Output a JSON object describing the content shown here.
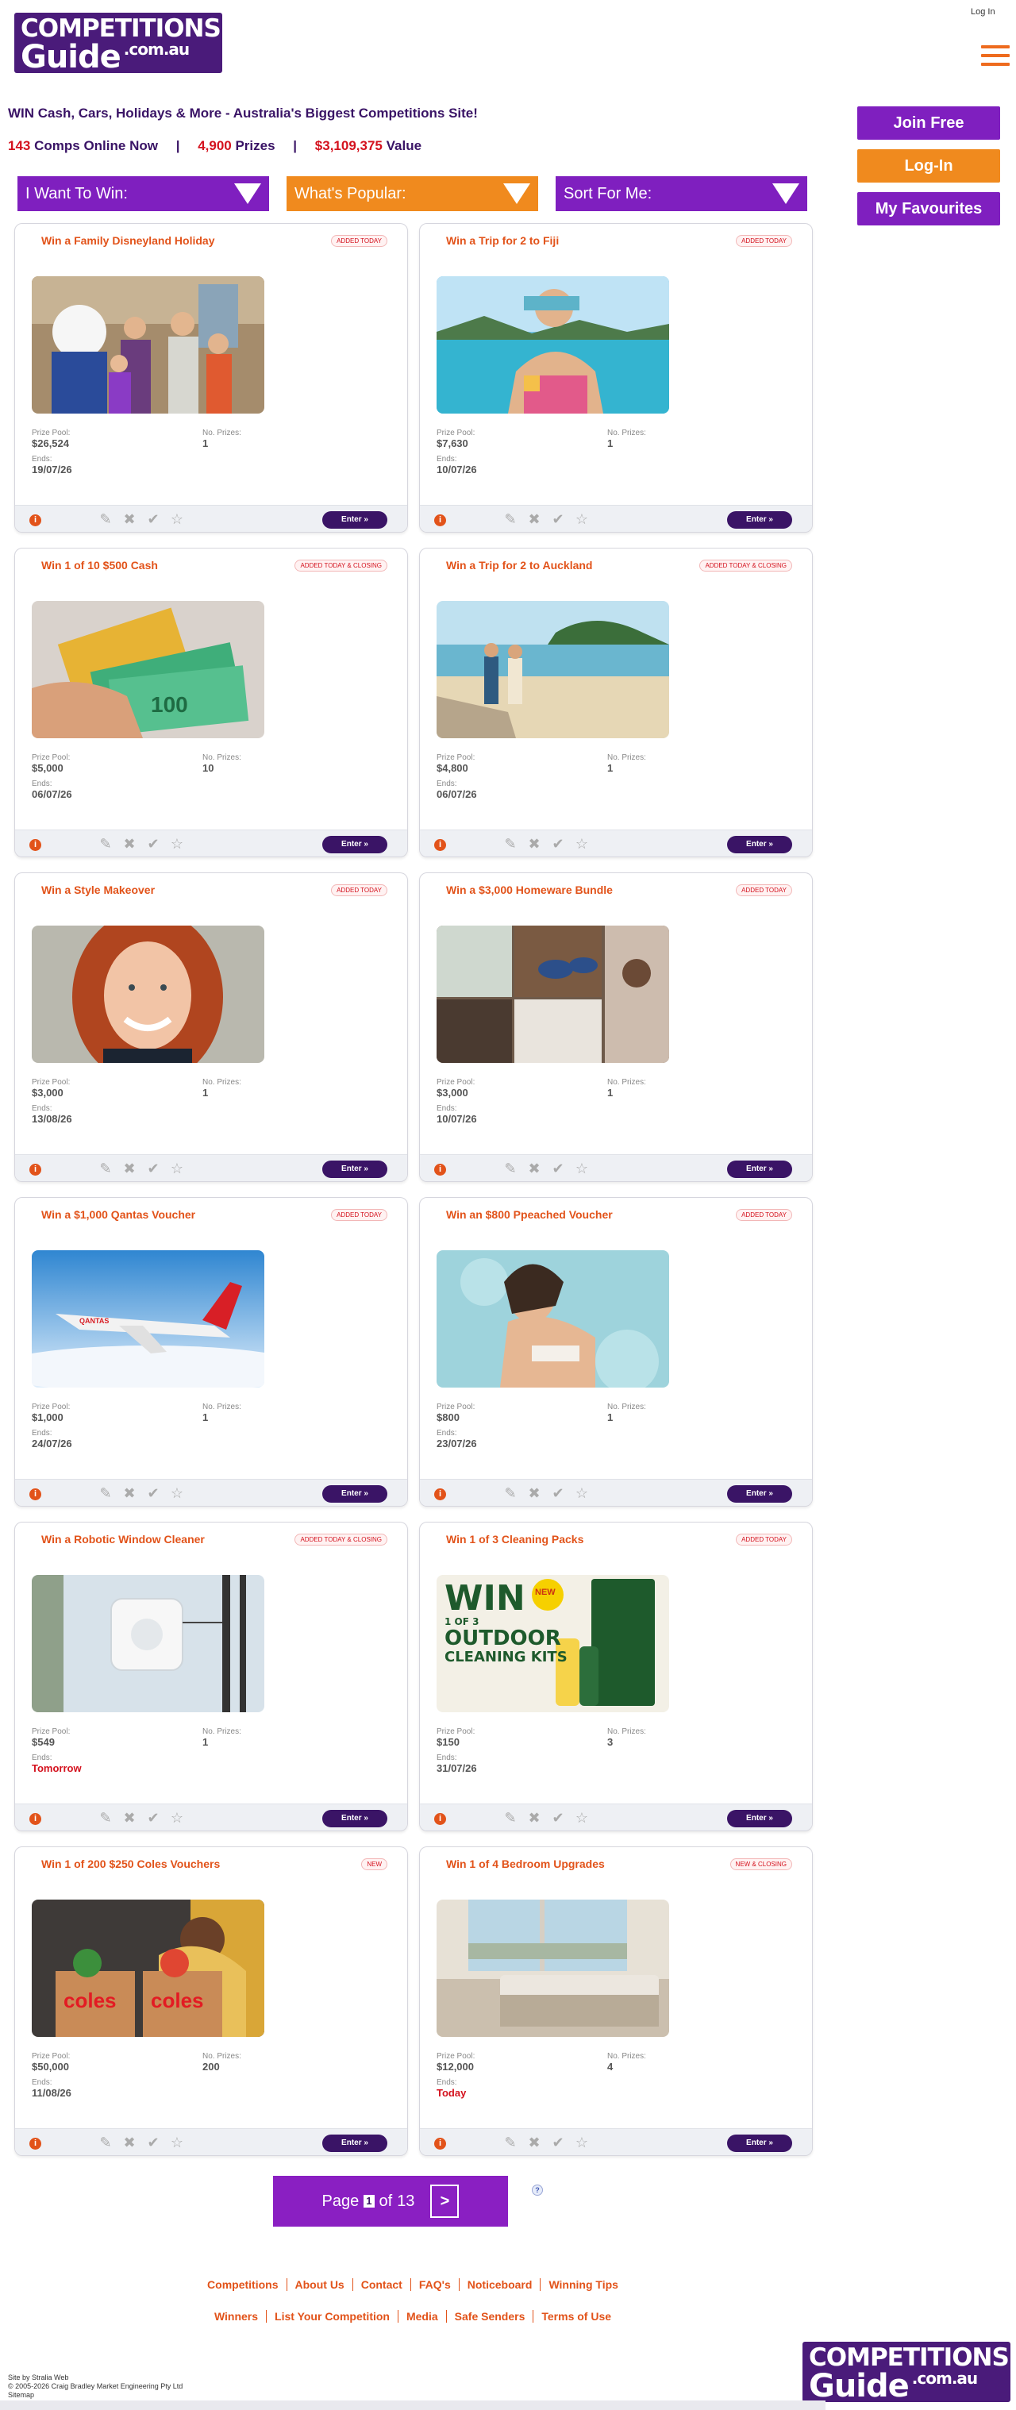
{
  "header": {
    "logo_line1": "COMPETITIONS",
    "logo_line2": "Guide",
    "logo_suffix": ".com.au",
    "login_link": "Log In",
    "menu_icon": "hamburger-menu-icon"
  },
  "intro": {
    "tagline": "WIN Cash, Cars, Holidays & More - Australia's Biggest Competitions Site!",
    "comps_count": "143",
    "comps_label": "Comps Online Now",
    "prizes_count": "4,900",
    "prizes_label": "Prizes",
    "value_amount": "$3,109,375",
    "value_label": "Value",
    "separator": "|"
  },
  "side": {
    "join": "Join Free",
    "login": "Log-In",
    "favourites": "My Favourites"
  },
  "filters": [
    {
      "label": "I Want To Win:",
      "color": "purple"
    },
    {
      "label": "What's Popular:",
      "color": "orange"
    },
    {
      "label": "Sort For Me:",
      "color": "purple"
    }
  ],
  "labels": {
    "prize_pool": "Prize Pool:",
    "no_prizes": "No. Prizes:",
    "ends": "Ends:",
    "enter": "Enter »",
    "info": "i"
  },
  "cards": [
    {
      "title": "Win a Family Disneyland Holiday",
      "badge": "ADDED TODAY",
      "pool": "$26,524",
      "prizes": "1",
      "ends": "19/07/26",
      "image": "disneyland-family-photo"
    },
    {
      "title": "Win a Trip for 2 to Fiji",
      "badge": "ADDED TODAY",
      "pool": "$7,630",
      "prizes": "1",
      "ends": "10/07/26",
      "image": "fiji-pool-photo"
    },
    {
      "title": "Win 1 of 10 $500 Cash",
      "badge": "ADDED TODAY & CLOSING",
      "pool": "$5,000",
      "prizes": "10",
      "ends": "06/07/26",
      "image": "cash-notes-photo"
    },
    {
      "title": "Win a Trip for 2 to Auckland",
      "badge": "ADDED TODAY & CLOSING",
      "pool": "$4,800",
      "prizes": "1",
      "ends": "06/07/26",
      "image": "auckland-beach-photo"
    },
    {
      "title": "Win a Style Makeover",
      "badge": "ADDED TODAY",
      "pool": "$3,000",
      "prizes": "1",
      "ends": "13/08/26",
      "image": "woman-portrait-photo"
    },
    {
      "title": "Win a $3,000 Homeware Bundle",
      "badge": "ADDED TODAY",
      "pool": "$3,000",
      "prizes": "1",
      "ends": "10/07/26",
      "image": "homeware-collage-photo"
    },
    {
      "title": "Win a $1,000 Qantas Voucher",
      "badge": "ADDED TODAY",
      "pool": "$1,000",
      "prizes": "1",
      "ends": "24/07/26",
      "image": "qantas-plane-photo"
    },
    {
      "title": "Win an $800 Ppeached Voucher",
      "badge": "ADDED TODAY",
      "pool": "$800",
      "prizes": "1",
      "ends": "23/07/26",
      "image": "swimwear-pool-photo"
    },
    {
      "title": "Win a Robotic Window Cleaner",
      "badge": "ADDED TODAY & CLOSING",
      "pool": "$549",
      "prizes": "1",
      "ends": "Tomorrow",
      "ends_urgent": true,
      "image": "window-robot-photo"
    },
    {
      "title": "Win 1 of 3 Cleaning Packs",
      "badge": "ADDED TODAY",
      "pool": "$150",
      "prizes": "3",
      "ends": "31/07/26",
      "image": "cleaning-kits-ad",
      "ad_text": "WIN",
      "ad_sub": "1 OF 3",
      "ad_line2": "OUTDOOR",
      "ad_line3": "CLEANING KITS",
      "ad_new": "NEW"
    },
    {
      "title": "Win 1 of 200 $250 Coles Vouchers",
      "badge": "NEW",
      "pool": "$50,000",
      "prizes": "200",
      "ends": "11/08/26",
      "image": "coles-bags-photo",
      "bag_text": "coles"
    },
    {
      "title": "Win 1 of 4 Bedroom Upgrades",
      "badge": "NEW & CLOSING",
      "pool": "$12,000",
      "prizes": "4",
      "ends": "Today",
      "ends_urgent": true,
      "image": "bedroom-photo"
    }
  ],
  "pager": {
    "page_word": "Page",
    "current": "1",
    "of_word": "of",
    "total": "13",
    "next": ">",
    "help": "?"
  },
  "footer": {
    "row1": [
      "Competitions",
      "About Us",
      "Contact",
      "FAQ's",
      "Noticeboard",
      "Winning Tips"
    ],
    "row2": [
      "Winners",
      "List Your Competition",
      "Media",
      "Safe Senders",
      "Terms of Use"
    ],
    "site_by": "Site by Stralia Web",
    "copyright": "© 2005-2026 Craig Bradley Market Engineering Pty Ltd",
    "sitemap": "Sitemap"
  },
  "colors": {
    "brand_purple": "#4a1b7a",
    "button_purple": "#7f1fbf",
    "orange": "#f08a1e",
    "title_orange": "#e2531a",
    "red": "#d4121e"
  }
}
